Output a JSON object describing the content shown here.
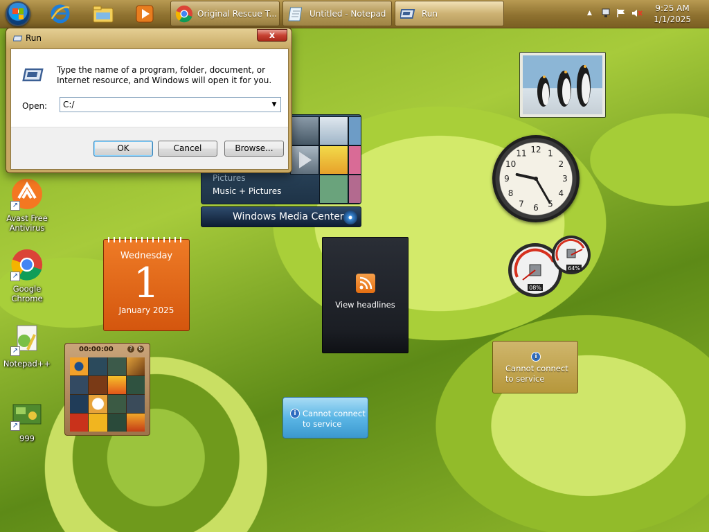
{
  "taskbar": {
    "buttons": [
      {
        "label": "Original Rescue T..."
      },
      {
        "label": "Untitled - Notepad"
      },
      {
        "label": "Run"
      }
    ],
    "clock": {
      "time": "9:25 AM",
      "date": "1/1/2025"
    }
  },
  "desktop_icons": [
    {
      "label": "Avast Free Antivirus"
    },
    {
      "label": "Google Chrome"
    },
    {
      "label": "Notepad++"
    },
    {
      "label": "999"
    }
  ],
  "run_dialog": {
    "title": "Run",
    "description": "Type the name of a program, folder, document, or Internet resource, and Windows will open it for you.",
    "open_label": "Open:",
    "open_value": "C:/",
    "ok_label": "OK",
    "cancel_label": "Cancel",
    "browse_label": "Browse...",
    "close_glyph": "x"
  },
  "gadgets": {
    "media_center": {
      "line1": "Pictures",
      "line2": "Music + Pictures",
      "bar_label": "Windows Media Center"
    },
    "calendar": {
      "weekday": "Wednesday",
      "day": "1",
      "month_year": "January 2025"
    },
    "puzzle": {
      "timer": "00:00:00"
    },
    "feed": {
      "label": "View headlines"
    },
    "weather_blue": {
      "line1": "Cannot connect",
      "line2": "to service"
    },
    "weather_gold": {
      "line1": "Cannot connect",
      "line2": "to service"
    },
    "cpu_meter": {
      "cpu": "08%",
      "memory": "64%"
    },
    "clock": {
      "hour": 9,
      "minute": 25,
      "numbers": [
        "12",
        "1",
        "2",
        "3",
        "4",
        "5",
        "6",
        "7",
        "8",
        "9",
        "10",
        "11"
      ]
    }
  },
  "colors": {
    "taskbar": "#8f7230",
    "calendar": "#e06a1a",
    "weather_blue": "#5bb6e5",
    "weather_gold": "#c2a450",
    "accent_blue": "#3c7fb1"
  }
}
